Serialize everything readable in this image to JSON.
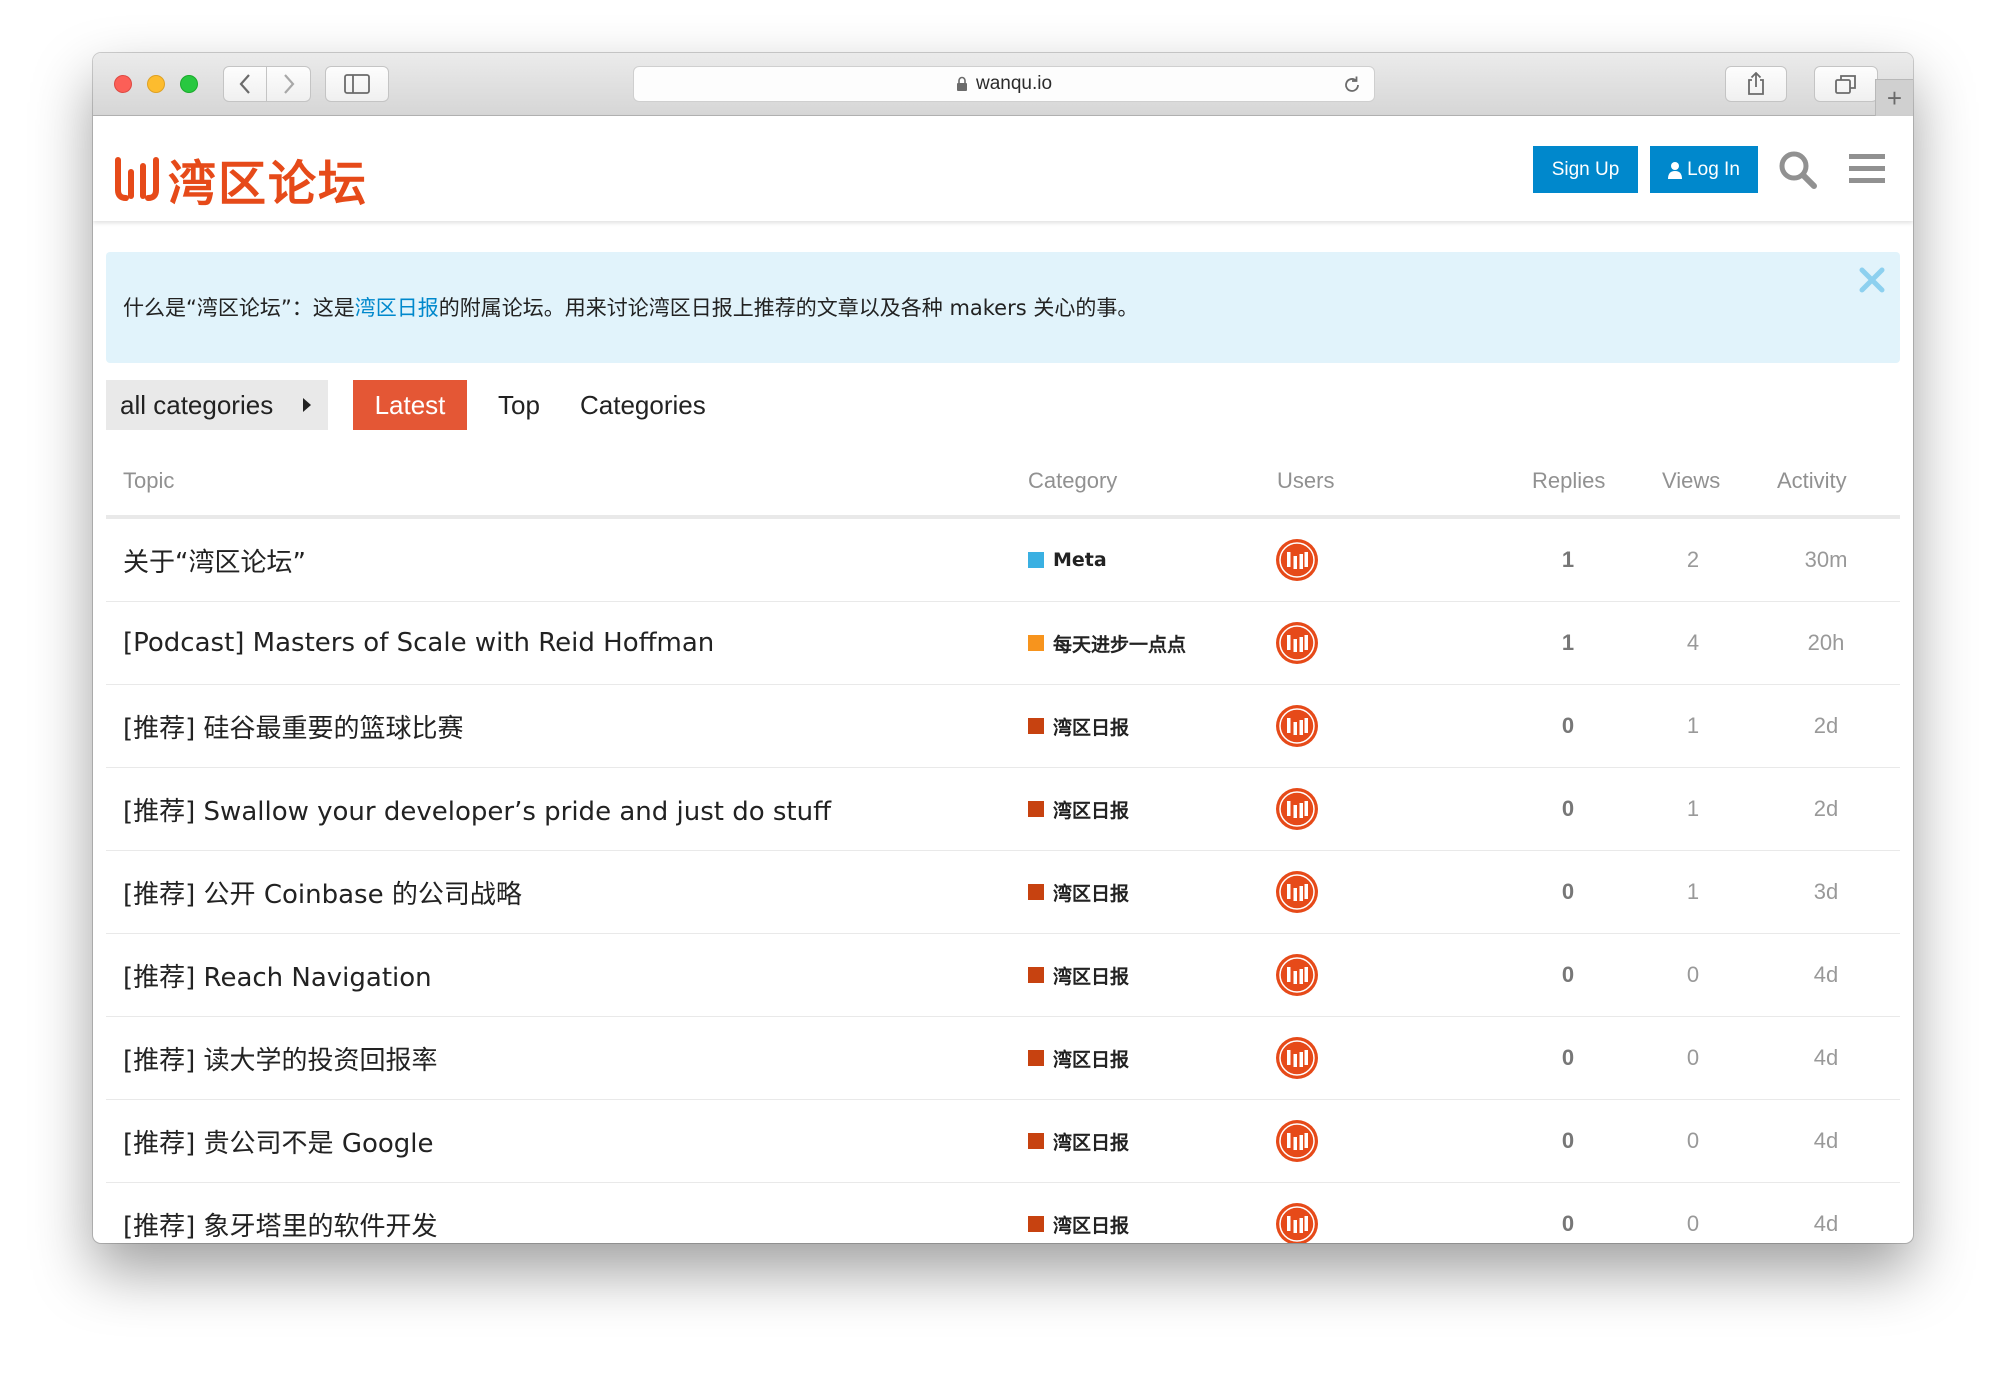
{
  "browser": {
    "url": "wanqu.io"
  },
  "header": {
    "logo_text": "湾区论坛",
    "signup_label": "Sign Up",
    "login_label": "Log In",
    "brand_color": "#e64a19",
    "button_color": "#0088cc"
  },
  "banner": {
    "prefix": "什么是“湾区论坛”：这是",
    "link_text": "湾区日报",
    "suffix": "的附属论坛。用来讨论湾区日报上推荐的文章以及各种 makers 关心的事。"
  },
  "nav": {
    "category_dropdown": "all categories",
    "tabs": [
      "Latest",
      "Top",
      "Categories"
    ],
    "active_tab": "Latest",
    "active_color": "#e45735"
  },
  "table": {
    "headers": {
      "topic": "Topic",
      "category": "Category",
      "users": "Users",
      "replies": "Replies",
      "views": "Views",
      "activity": "Activity"
    },
    "rows": [
      {
        "title": "关于“湾区论坛”",
        "category": "Meta",
        "category_color": "#3ab0e2",
        "replies": "1",
        "views": "2",
        "activity": "30m"
      },
      {
        "title": "[Podcast] Masters of Scale with Reid Hoffman",
        "category": "每天进步一点点",
        "category_color": "#f7941d",
        "replies": "1",
        "views": "4",
        "activity": "20h"
      },
      {
        "title": "[推荐] 硅谷最重要的篮球比赛",
        "category": "湾区日报",
        "category_color": "#c74210",
        "replies": "0",
        "views": "1",
        "activity": "2d"
      },
      {
        "title": "[推荐] Swallow your developer’s pride and just do stuff",
        "category": "湾区日报",
        "category_color": "#c74210",
        "replies": "0",
        "views": "1",
        "activity": "2d"
      },
      {
        "title": "[推荐] 公开 Coinbase 的公司战略",
        "category": "湾区日报",
        "category_color": "#c74210",
        "replies": "0",
        "views": "1",
        "activity": "3d"
      },
      {
        "title": "[推荐] Reach Navigation",
        "category": "湾区日报",
        "category_color": "#c74210",
        "replies": "0",
        "views": "0",
        "activity": "4d"
      },
      {
        "title": "[推荐] 读大学的投资回报率",
        "category": "湾区日报",
        "category_color": "#c74210",
        "replies": "0",
        "views": "0",
        "activity": "4d"
      },
      {
        "title": "[推荐] 贵公司不是 Google",
        "category": "湾区日报",
        "category_color": "#c74210",
        "replies": "0",
        "views": "0",
        "activity": "4d"
      },
      {
        "title": "[推荐] 象牙塔里的软件开发",
        "category": "湾区日报",
        "category_color": "#c74210",
        "replies": "0",
        "views": "0",
        "activity": "4d"
      }
    ]
  }
}
